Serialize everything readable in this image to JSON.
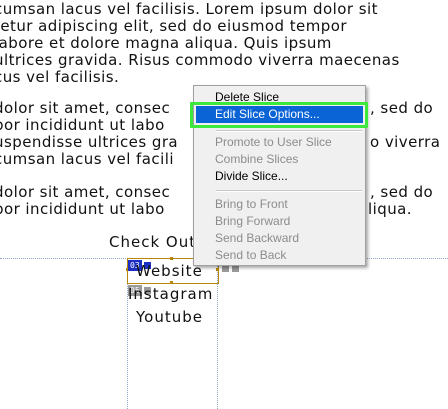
{
  "paragraphs": [
    [
      "cumsan lacus vel facilisis. Lorem ipsum dolor sit",
      "tetur adipiscing elit, sed do eiusmod tempor",
      " labore et dolore magna aliqua. Quis ipsum",
      "ultrices gravida. Risus commodo viverra maecenas",
      "cus vel facilisis."
    ],
    [
      " dolor sit amet, consec",
      "por incididunt ut labo",
      "uspendisse ultrices gra",
      "cumsan lacus vel facili"
    ],
    [
      " dolor sit amet, consec",
      "por incididunt ut labo"
    ]
  ],
  "paragraph_tails": [
    [
      "",
      "",
      "",
      "",
      ""
    ],
    [
      ", sed do",
      "",
      "o viverra",
      ""
    ],
    [
      ", sed do",
      "liqua."
    ]
  ],
  "check_out_label": "Check Out",
  "list_items": [
    "Website",
    "Instagram",
    "Youtube"
  ],
  "slice_badges": [
    {
      "number": "03",
      "style": "blue"
    },
    {
      "number": "05",
      "style": "gray"
    }
  ],
  "context_menu": {
    "items": [
      {
        "label": "Delete Slice",
        "state": "enabled"
      },
      {
        "label": "Edit Slice Options...",
        "state": "selected"
      },
      {
        "separator": true
      },
      {
        "label": "Promote to User Slice",
        "state": "disabled"
      },
      {
        "label": "Combine Slices",
        "state": "disabled"
      },
      {
        "label": "Divide Slice...",
        "state": "enabled"
      },
      {
        "separator": true
      },
      {
        "label": "Bring to Front",
        "state": "disabled"
      },
      {
        "label": "Bring Forward",
        "state": "disabled"
      },
      {
        "label": "Send Backward",
        "state": "disabled"
      },
      {
        "label": "Send to Back",
        "state": "disabled"
      }
    ]
  },
  "colors": {
    "menu_selection": "#0a64d6",
    "highlight_ring": "#3ce83c",
    "slice_border": "#b8860b",
    "badge_blue": "#1b2fc4",
    "guide_line": "#8fa4c8"
  }
}
